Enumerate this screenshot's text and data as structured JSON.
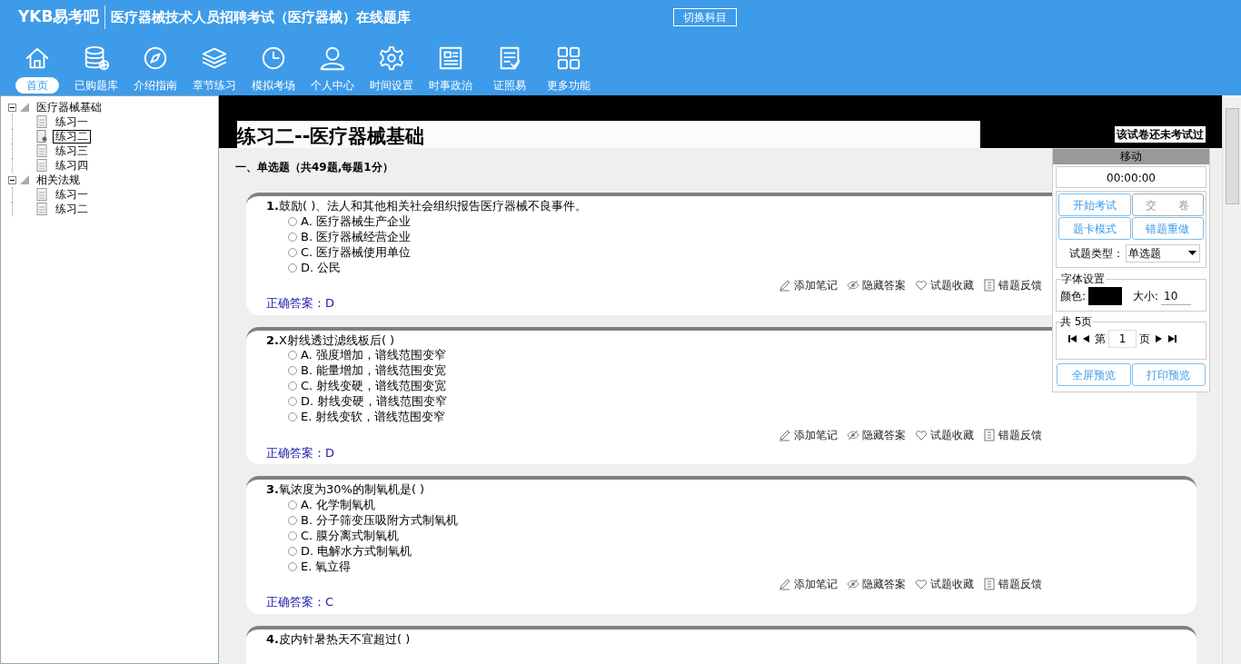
{
  "header": {
    "logo": "YKB易考吧",
    "title": "医疗器械技术人员招聘考试（医疗器械）在线题库",
    "switch_button": "切换科目"
  },
  "nav": [
    {
      "label": "首页",
      "selected": true
    },
    {
      "label": "已购题库",
      "selected": false
    },
    {
      "label": "介绍指南",
      "selected": false
    },
    {
      "label": "章节练习",
      "selected": false
    },
    {
      "label": "模拟考场",
      "selected": false
    },
    {
      "label": "个人中心",
      "selected": false
    },
    {
      "label": "时间设置",
      "selected": false
    },
    {
      "label": "时事政治",
      "selected": false
    },
    {
      "label": "证照易",
      "selected": false
    },
    {
      "label": "更多功能",
      "selected": false
    }
  ],
  "tree": [
    {
      "label": "医疗器械基础",
      "expanded": true,
      "children": [
        {
          "label": "练习一",
          "selected": false
        },
        {
          "label": "练习二",
          "selected": true
        },
        {
          "label": "练习三",
          "selected": false
        },
        {
          "label": "练习四",
          "selected": false
        }
      ]
    },
    {
      "label": "相关法规",
      "expanded": true,
      "children": [
        {
          "label": "练习一",
          "selected": false
        },
        {
          "label": "练习二",
          "selected": false
        }
      ]
    }
  ],
  "exam": {
    "title": "练习二--医疗器械基础",
    "status": "该试卷还未考试过",
    "section_heading": "一、单选题（共49题,每题1分）",
    "questions": [
      {
        "number": "1.",
        "text": "鼓励( )、法人和其他相关社会组织报告医疗器械不良事件。",
        "options": [
          {
            "letter": "A.",
            "text": "医疗器械生产企业",
            "selected": false
          },
          {
            "letter": "B.",
            "text": "医疗器械经营企业",
            "selected": false
          },
          {
            "letter": "C.",
            "text": "医疗器械使用单位",
            "selected": false
          },
          {
            "letter": "D.",
            "text": "公民",
            "selected": false
          }
        ],
        "answer_label": "正确答案：",
        "answer": "D",
        "actions": [
          "添加笔记",
          "隐藏答案",
          "试题收藏",
          "错题反馈"
        ]
      },
      {
        "number": "2.",
        "text": "X射线透过滤线板后( )",
        "options": [
          {
            "letter": "A.",
            "text": "强度增加，谱线范围变窄",
            "selected": false
          },
          {
            "letter": "B.",
            "text": "能量增加，谱线范围变宽",
            "selected": false
          },
          {
            "letter": "C.",
            "text": "射线变硬，谱线范围变宽",
            "selected": false
          },
          {
            "letter": "D.",
            "text": "射线变硬，谱线范围变窄",
            "selected": false
          },
          {
            "letter": "E.",
            "text": "射线变软，谱线范围变窄",
            "selected": false
          }
        ],
        "answer_label": "正确答案：",
        "answer": "D",
        "actions": [
          "添加笔记",
          "隐藏答案",
          "试题收藏",
          "错题反馈"
        ]
      },
      {
        "number": "3.",
        "text": "氧浓度为30%的制氧机是( )",
        "options": [
          {
            "letter": "A.",
            "text": "化学制氧机",
            "selected": false
          },
          {
            "letter": "B.",
            "text": "分子筛变压吸附方式制氧机",
            "selected": false
          },
          {
            "letter": "C.",
            "text": "膜分离式制氧机",
            "selected": false
          },
          {
            "letter": "D.",
            "text": "电解水方式制氧机",
            "selected": false
          },
          {
            "letter": "E.",
            "text": "氧立得",
            "selected": false
          }
        ],
        "answer_label": "正确答案：",
        "answer": "C",
        "actions": [
          "添加笔记",
          "隐藏答案",
          "试题收藏",
          "错题反馈"
        ]
      },
      {
        "number": "4.",
        "text": "皮内针暑热天不宜超过( )"
      }
    ]
  },
  "panel": {
    "move_label": "移动",
    "timer": "00:00:00",
    "buttons": [
      "开始考试",
      "交　　卷",
      "题卡模式",
      "错题重做"
    ],
    "type_label": "试题类型：",
    "type_value": "单选题",
    "font_legend": "字体设置",
    "color_label": "颜色:",
    "size_label": "大小:",
    "size": "10",
    "pages_legend": "共 5页",
    "page_prefix": "第",
    "page": "1",
    "page_suffix": "页",
    "preview_buttons": [
      "全屏预览",
      "打印预览"
    ]
  }
}
